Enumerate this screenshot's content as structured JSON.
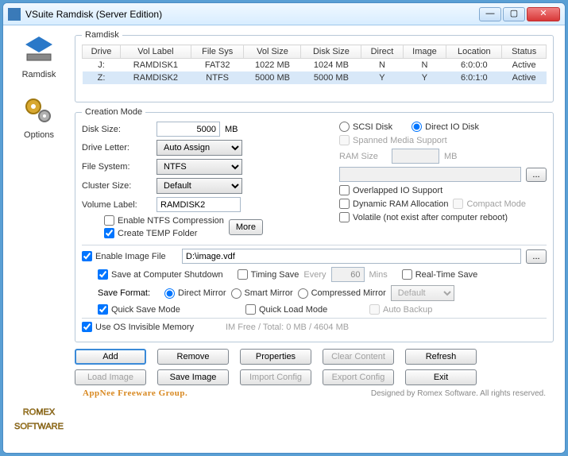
{
  "window": {
    "title": "VSuite Ramdisk (Server Edition)"
  },
  "sidebar": {
    "items": [
      {
        "label": "Ramdisk"
      },
      {
        "label": "Options"
      }
    ]
  },
  "ramdisk_section": {
    "legend": "Ramdisk",
    "columns": [
      "Drive",
      "Vol Label",
      "File Sys",
      "Vol Size",
      "Disk Size",
      "Direct",
      "Image",
      "Location",
      "Status"
    ],
    "rows": [
      {
        "drive": "J:",
        "label": "RAMDISK1",
        "fs": "FAT32",
        "volsize": "1022 MB",
        "disksize": "1024 MB",
        "direct": "N",
        "image": "N",
        "location": "6:0:0:0",
        "status": "Active"
      },
      {
        "drive": "Z:",
        "label": "RAMDISK2",
        "fs": "NTFS",
        "volsize": "5000 MB",
        "disksize": "5000 MB",
        "direct": "Y",
        "image": "Y",
        "location": "6:0:1:0",
        "status": "Active"
      }
    ]
  },
  "creation": {
    "legend": "Creation Mode",
    "disk_size_label": "Disk Size:",
    "disk_size_value": "5000",
    "mb": "MB",
    "scsi": "SCSI Disk",
    "directio": "Direct IO Disk",
    "drive_letter_label": "Drive Letter:",
    "drive_letter_value": "Auto Assign",
    "spanned": "Spanned Media Support",
    "filesystem_label": "File System:",
    "filesystem_value": "NTFS",
    "ramsize_label": "RAM Size",
    "ramsize_value": "",
    "cluster_label": "Cluster Size:",
    "cluster_value": "Default",
    "browse": "...",
    "volume_label_label": "Volume Label:",
    "volume_label_value": "RAMDISK2",
    "overlapped": "Overlapped IO Support",
    "ntfs_comp": "Enable NTFS Compression",
    "dynamic": "Dynamic RAM Allocation",
    "compact": "Compact Mode",
    "temp_folder": "Create TEMP Folder",
    "more": "More",
    "volatile": "Volatile (not exist after computer reboot)",
    "enable_image": "Enable Image File",
    "image_path": "D:\\image.vdf",
    "save_shutdown": "Save at Computer Shutdown",
    "timing_save": "Timing Save",
    "every": "Every",
    "every_value": "60",
    "mins": "Mins",
    "realtime": "Real-Time Save",
    "save_format": "Save Format:",
    "direct_mirror": "Direct Mirror",
    "smart_mirror": "Smart Mirror",
    "compressed_mirror": "Compressed Mirror",
    "compress_default": "Default",
    "quick_save": "Quick Save Mode",
    "quick_load": "Quick Load Mode",
    "auto_backup": "Auto Backup",
    "use_invisible": "Use OS Invisible Memory",
    "im_stats": "IM Free / Total: 0 MB / 4604 MB"
  },
  "buttons": {
    "add": "Add",
    "remove": "Remove",
    "properties": "Properties",
    "clear": "Clear Content",
    "refresh": "Refresh",
    "load_image": "Load Image",
    "save_image": "Save Image",
    "import_config": "Import Config",
    "export_config": "Export Config",
    "exit": "Exit"
  },
  "footer": {
    "appnee": "AppNee Freeware Group.",
    "designed": "Designed by Romex Software. All rights reserved."
  }
}
